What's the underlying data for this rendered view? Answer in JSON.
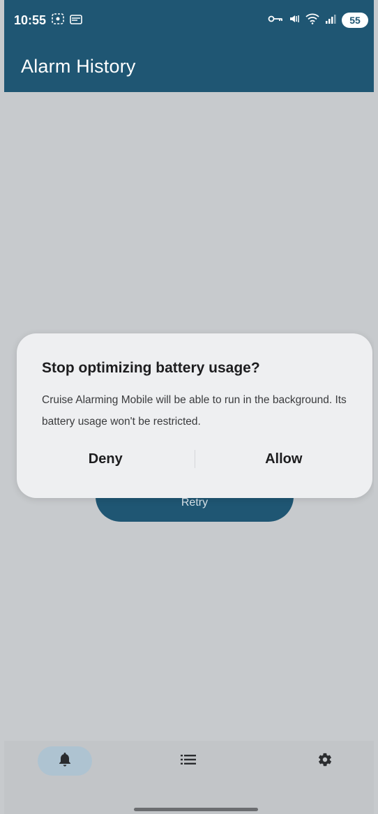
{
  "status_bar": {
    "time": "10:55",
    "battery": "55"
  },
  "app_bar": {
    "title": "Alarm History"
  },
  "background": {
    "retry_label": "Retry"
  },
  "dialog": {
    "title": "Stop optimizing battery usage?",
    "body": "Cruise Alarming Mobile will be able to run in the background. Its battery usage won't be restricted.",
    "deny_label": "Deny",
    "allow_label": "Allow"
  },
  "bottom_nav": {
    "items": [
      {
        "icon": "bell-icon",
        "selected": true
      },
      {
        "icon": "list-icon",
        "selected": false
      },
      {
        "icon": "gear-icon",
        "selected": false
      }
    ]
  },
  "colors": {
    "primary": "#1f5673",
    "scrim": "#c7cacd",
    "nav_pill": "#aec3d1"
  }
}
